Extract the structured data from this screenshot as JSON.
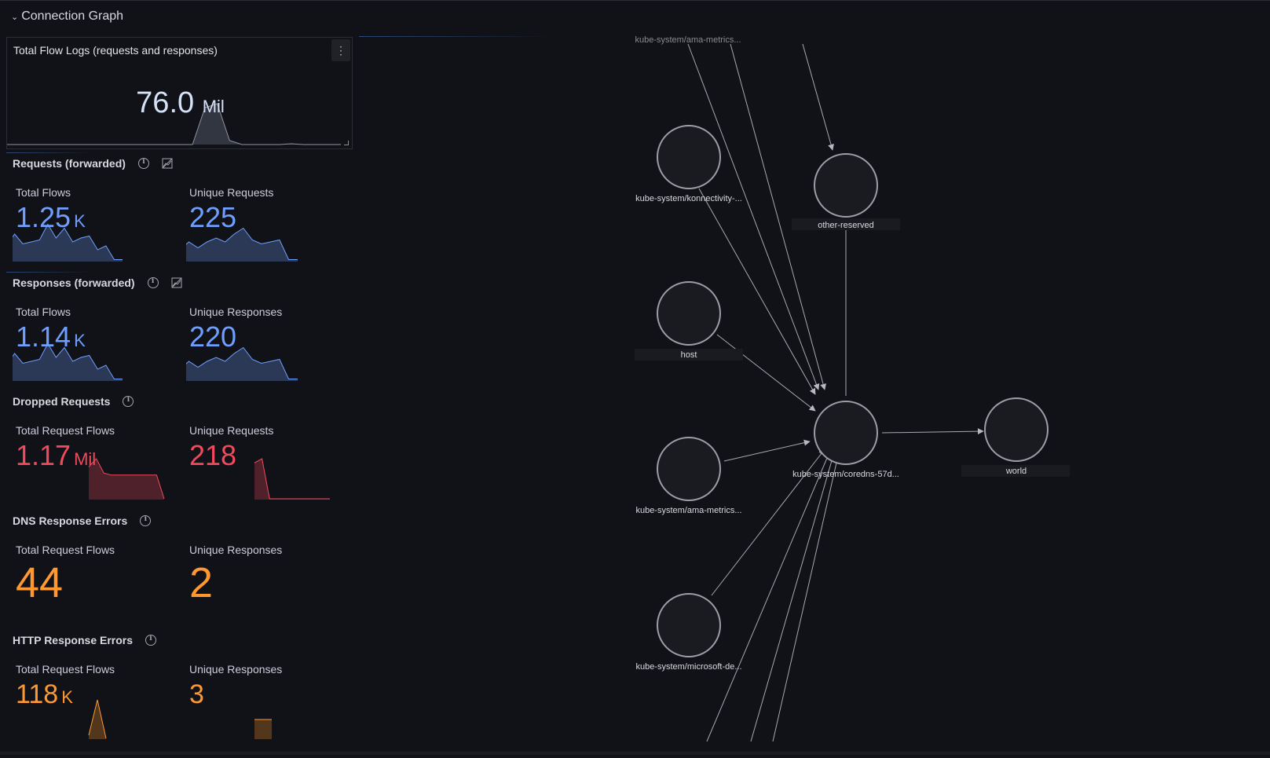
{
  "row": {
    "title": "Connection Graph"
  },
  "total_flow_logs": {
    "title": "Total Flow Logs (requests and responses)",
    "value": "76.0",
    "unit": "Mil",
    "menu_icon": "kebab-icon",
    "sparkline": [
      0,
      0,
      0,
      0,
      0,
      0,
      0,
      0,
      0,
      0,
      0,
      0,
      0,
      0,
      0,
      0,
      0.9,
      1,
      0.1,
      0,
      0,
      0,
      0,
      0.02,
      0,
      0,
      0,
      0
    ]
  },
  "sections": [
    {
      "id": "requests-forwarded",
      "title": "Requests (forwarded)",
      "has_chart_toggle": true,
      "stats": [
        {
          "label": "Total Flows",
          "value": "1.25",
          "unit": "K",
          "color": "#6e9fff",
          "spark": [
            0.4,
            0.7,
            0.45,
            0.5,
            0.55,
            0.95,
            0.6,
            0.85,
            0.5,
            0.6,
            0.65,
            0.3,
            0.4,
            0.05,
            0.05
          ]
        },
        {
          "label": "Unique Requests",
          "value": "225",
          "unit": "",
          "color": "#6e9fff",
          "spark": [
            0.3,
            0.5,
            0.35,
            0.5,
            0.6,
            0.5,
            0.7,
            0.85,
            0.55,
            0.45,
            0.5,
            0.55,
            0.05,
            0.05
          ]
        }
      ]
    },
    {
      "id": "responses-forwarded",
      "title": "Responses (forwarded)",
      "has_chart_toggle": true,
      "stats": [
        {
          "label": "Total Flows",
          "value": "1.14",
          "unit": "K",
          "color": "#6e9fff",
          "spark": [
            0.4,
            0.7,
            0.45,
            0.5,
            0.55,
            0.95,
            0.6,
            0.85,
            0.5,
            0.6,
            0.65,
            0.3,
            0.4,
            0.05,
            0.05
          ]
        },
        {
          "label": "Unique Responses",
          "value": "220",
          "unit": "",
          "color": "#6e9fff",
          "spark": [
            0.3,
            0.5,
            0.35,
            0.5,
            0.6,
            0.5,
            0.7,
            0.85,
            0.55,
            0.45,
            0.5,
            0.55,
            0.05,
            0.05
          ]
        }
      ]
    },
    {
      "id": "dropped-requests",
      "title": "Dropped Requests",
      "has_chart_toggle": false,
      "stats": [
        {
          "label": "Total Request Flows",
          "value": "1.17",
          "unit": "Mil",
          "color": "#f2495c",
          "spark": [
            0.8,
            1,
            0.65,
            0.6,
            0.6,
            0.6,
            0.6,
            0.6,
            0.6,
            0.6,
            0.02
          ]
        },
        {
          "label": "Unique Requests",
          "value": "218",
          "unit": "",
          "color": "#f2495c",
          "spark": [
            0.9,
            1,
            0.02,
            0.02,
            0.02,
            0.02,
            0.02,
            0.02,
            0.02,
            0.02,
            0.02
          ]
        }
      ]
    },
    {
      "id": "dns-response-errors",
      "title": "DNS Response Errors",
      "has_chart_toggle": false,
      "stats": [
        {
          "label": "Total Request Flows",
          "value": "44",
          "unit": "",
          "color": "#ff9830",
          "spark": []
        },
        {
          "label": "Unique Responses",
          "value": "2",
          "unit": "",
          "color": "#ff9830",
          "spark": []
        }
      ]
    },
    {
      "id": "http-response-errors",
      "title": "HTTP Response Errors",
      "has_chart_toggle": false,
      "stats": [
        {
          "label": "Total Request Flows",
          "value": "118",
          "unit": "K",
          "color": "#ff9830",
          "spark": [
            0.1,
            1,
            0.02
          ]
        },
        {
          "label": "Unique Responses",
          "value": "3",
          "unit": "",
          "color": "#ff9830",
          "spark": [
            1,
            1,
            1
          ]
        }
      ]
    }
  ],
  "graph": {
    "nodes": [
      {
        "id": "top-partial",
        "label": "kube-system/ama-metrics..."
      },
      {
        "id": "konnectivity",
        "label": "kube-system/konnectivity-..."
      },
      {
        "id": "other-reserved",
        "label": "other-reserved"
      },
      {
        "id": "host",
        "label": "host"
      },
      {
        "id": "ama-metrics",
        "label": "kube-system/ama-metrics..."
      },
      {
        "id": "coredns",
        "label": "kube-system/coredns-57d..."
      },
      {
        "id": "world",
        "label": "world"
      },
      {
        "id": "microsoft-de",
        "label": "kube-system/microsoft-de..."
      }
    ]
  }
}
